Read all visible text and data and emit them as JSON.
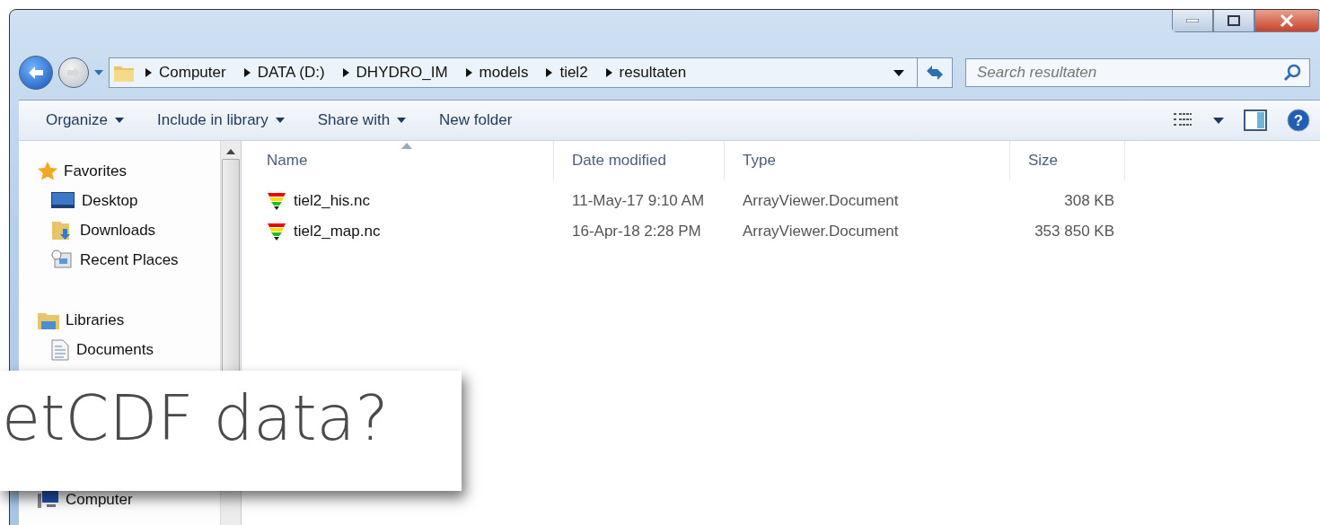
{
  "address": {
    "breadcrumbs": [
      "Computer",
      "DATA (D:)",
      "DHYDRO_IM",
      "models",
      "tiel2",
      "resultaten"
    ]
  },
  "search": {
    "placeholder": "Search resultaten"
  },
  "toolbar": [
    {
      "label": "Organize",
      "kind": "menu"
    },
    {
      "label": "Include in library",
      "kind": "menu"
    },
    {
      "label": "Share with",
      "kind": "menu"
    },
    {
      "label": "New folder",
      "kind": "plain"
    }
  ],
  "sidebar": [
    {
      "label": "Favorites",
      "children": [
        {
          "label": "Desktop"
        },
        {
          "label": "Downloads"
        },
        {
          "label": "Recent Places"
        }
      ]
    },
    {
      "label": "Libraries",
      "children": [
        {
          "label": "Documents"
        }
      ]
    },
    {
      "label": "Computer"
    }
  ],
  "columns": [
    {
      "label": "Name",
      "sorted": true
    },
    {
      "label": "Date modified",
      "sorted": false
    },
    {
      "label": "Type",
      "sorted": false
    },
    {
      "label": "Size",
      "sorted": false
    }
  ],
  "rows": [
    {
      "name": "tiel2_his.nc",
      "date": "11-May-17 9:10 AM",
      "type": "ArrayViewer.Document",
      "size": "308 KB"
    },
    {
      "name": "tiel2_map.nc",
      "date": "16-Apr-18 2:28 PM",
      "type": "ArrayViewer.Document",
      "size": "353 850 KB"
    }
  ],
  "help": {
    "glyph": "?"
  },
  "caption": {
    "text": "etCDF data?"
  }
}
